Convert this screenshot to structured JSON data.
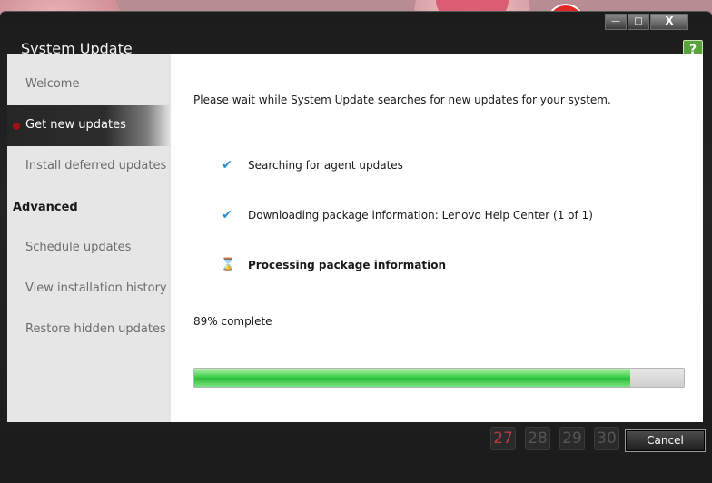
{
  "window": {
    "title": "System Update",
    "controls": {
      "minimize": "—",
      "maximize": "□",
      "close": "X"
    }
  },
  "icons": {
    "help": "help-icon",
    "check": "check-icon",
    "hourglass": "hourglass-icon",
    "logo": "update-logo-icon"
  },
  "sidebar": {
    "items": [
      {
        "label": "Welcome",
        "active": false
      },
      {
        "label": "Get new updates",
        "active": true
      },
      {
        "label": "Install deferred updates",
        "active": false
      }
    ],
    "section_heading": "Advanced",
    "advanced_items": [
      {
        "label": "Schedule updates"
      },
      {
        "label": "View installation history"
      },
      {
        "label": "Restore hidden updates"
      }
    ]
  },
  "main": {
    "intro": "Please wait while System Update searches for new updates for your system.",
    "steps": [
      {
        "status": "done",
        "text": "Searching for agent updates"
      },
      {
        "status": "done",
        "text": "Downloading package information: Lenovo Help Center (1 of 1)"
      },
      {
        "status": "in-progress",
        "text": "Processing package information"
      }
    ],
    "progress_text": "89% complete",
    "progress_value": 0.89
  },
  "footer": {
    "cancel_label": "Cancel"
  },
  "desktop": {
    "calendar_days": [
      "27",
      "28",
      "29",
      "30"
    ]
  },
  "colors": {
    "accent_green": "#3fd14a",
    "active_dot": "#a50e1b",
    "check_blue": "#2d8fd1"
  }
}
